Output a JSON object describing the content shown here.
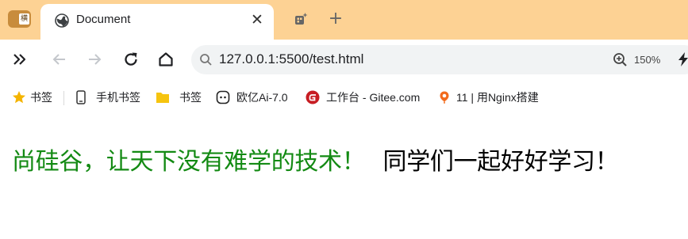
{
  "tab_strip": {
    "vertical_tabs_glyph": "横",
    "active_tab": {
      "title": "Document",
      "close_glyph": "✕"
    },
    "new_tab_glyph": "+"
  },
  "toolbar": {
    "address": "127.0.0.1:5500/test.html",
    "zoom": "150%",
    "icons": [
      "sidebar-expand-icon",
      "back-icon",
      "forward-icon",
      "reload-icon",
      "home-icon",
      "search-icon",
      "zoom-icon",
      "bolt-icon"
    ]
  },
  "bookmarks": [
    {
      "label": "书签",
      "icon": "star-icon"
    },
    {
      "label": "手机书签",
      "icon": "phone-icon"
    },
    {
      "label": "书签",
      "icon": "folder-icon"
    },
    {
      "label": "欧亿Ai-7.0",
      "icon": "chat-bubble-icon"
    },
    {
      "label": "工作台 - Gitee.com",
      "icon": "gitee-icon"
    },
    {
      "label": "11 | 用Nginx搭建",
      "icon": "balloon-icon"
    }
  ],
  "page": {
    "headline_green": "尚硅谷，让天下没有难学的技术！",
    "headline_black": "同学们一起好好学习！",
    "colors": {
      "green_text": "#138a13",
      "tab_strip_bg": "#fdd294"
    }
  }
}
